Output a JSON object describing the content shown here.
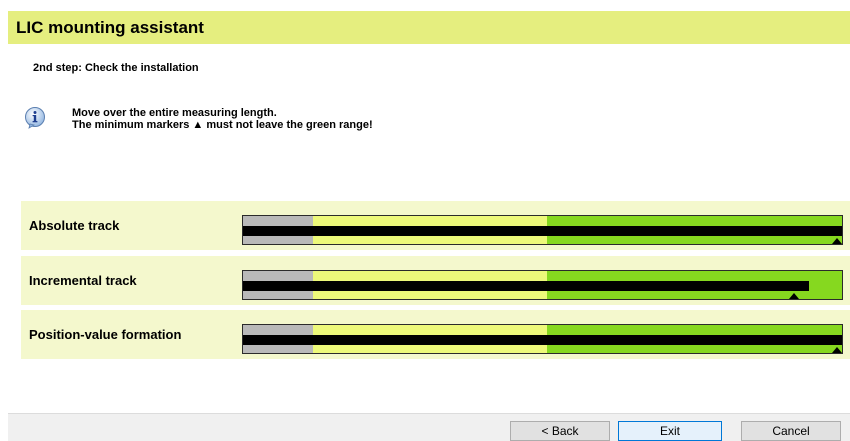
{
  "header": {
    "title": "LIC mounting assistant"
  },
  "step": {
    "label": "2nd step: Check the installation"
  },
  "info": {
    "icon": "info-icon",
    "line1": "Move over the entire measuring length.",
    "line2": "The minimum markers ▲ must not leave the green range!"
  },
  "tracks": [
    {
      "label": "Absolute track",
      "level_percent": 100,
      "min_marker_percent": 100
    },
    {
      "label": "Incremental track",
      "level_percent": 94.5,
      "min_marker_percent": 92
    },
    {
      "label": "Position-value formation",
      "level_percent": 100,
      "min_marker_percent": 100
    }
  ],
  "colors": {
    "header_bg": "#e5ee7f",
    "row_bg": "#f4f8cd",
    "range_gray": "#b9b9b9",
    "range_lime": "#edf97a",
    "range_green": "#86d81f"
  },
  "buttons": {
    "back": "< Back",
    "exit": "Exit",
    "cancel": "Cancel"
  }
}
